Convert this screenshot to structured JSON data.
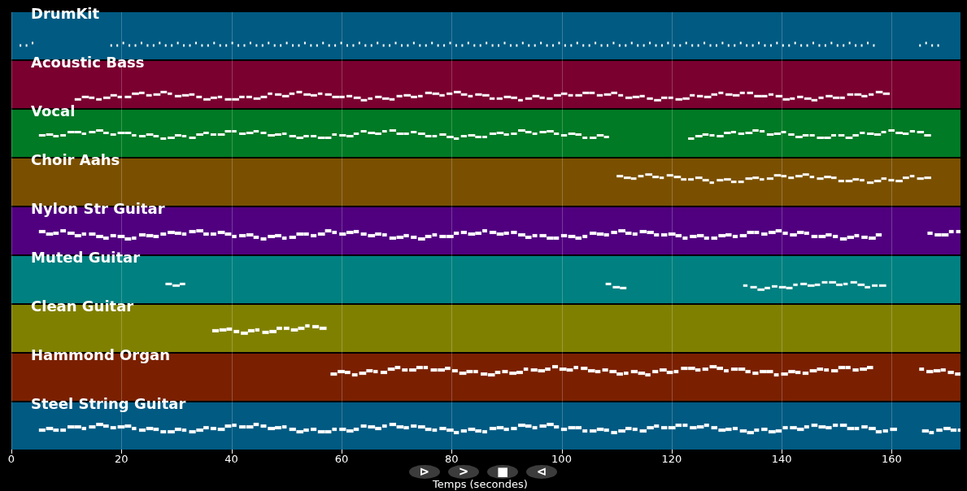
{
  "tracks": [
    {
      "name": "DrumKit",
      "color": "#005a82"
    },
    {
      "name": "Acoustic Bass",
      "color": "#7a0030"
    },
    {
      "name": "Vocal",
      "color": "#007a25"
    },
    {
      "name": "Choir Aahs",
      "color": "#7a5000"
    },
    {
      "name": "Nylon Str Guitar",
      "color": "#50007f"
    },
    {
      "name": "Muted Guitar",
      "color": "#008080"
    },
    {
      "name": "Clean Guitar",
      "color": "#808000"
    },
    {
      "name": "Hammond Organ",
      "color": "#7a2000"
    },
    {
      "name": "Steel String Guitar",
      "color": "#005a82"
    }
  ],
  "x_axis": {
    "ticks": [
      "0",
      "20",
      "40",
      "60",
      "80",
      "100",
      "120",
      "140",
      "160"
    ],
    "label": "Temps (secondes)"
  },
  "controls": [
    {
      "label": "⊳"
    },
    {
      "label": ">"
    },
    {
      "label": "■"
    },
    {
      "label": "⊲"
    }
  ]
}
